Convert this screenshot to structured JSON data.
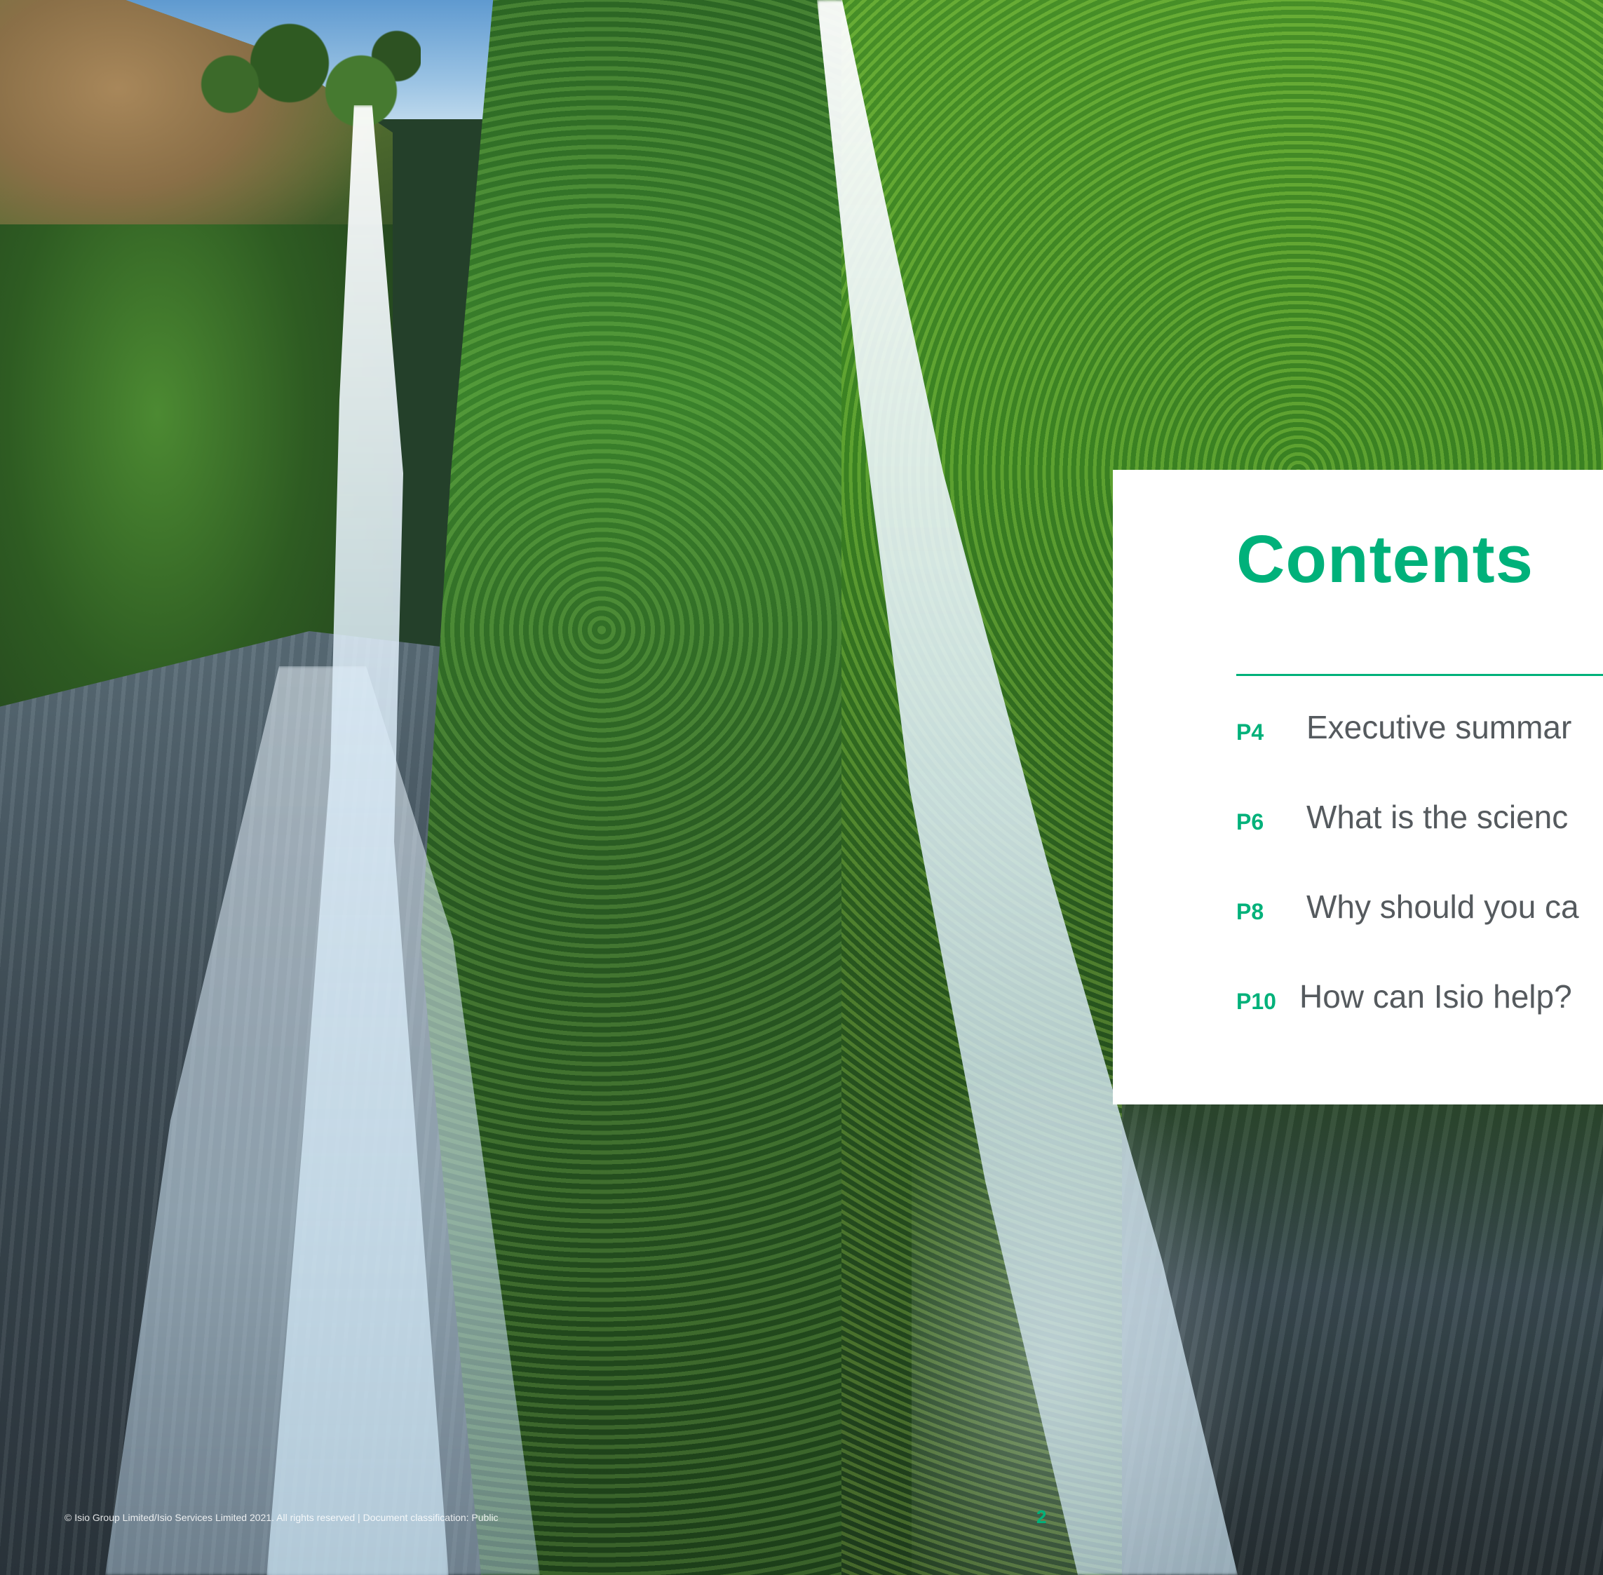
{
  "contents": {
    "title": "Contents",
    "items": [
      {
        "page": "P4",
        "label": "Executive summar"
      },
      {
        "page": "P6",
        "label": "What is the scienc"
      },
      {
        "page": "P8",
        "label": "Why should you ca"
      },
      {
        "page": "P10",
        "label": "How can Isio help?"
      }
    ]
  },
  "footer": {
    "legal": "© Isio Group Limited/Isio Services Limited 2021. All rights reserved | Document classification: Public",
    "page_number": "2"
  },
  "colors": {
    "accent": "#00b17a",
    "toc_text": "#555a5e",
    "panel_bg": "#ffffff"
  }
}
